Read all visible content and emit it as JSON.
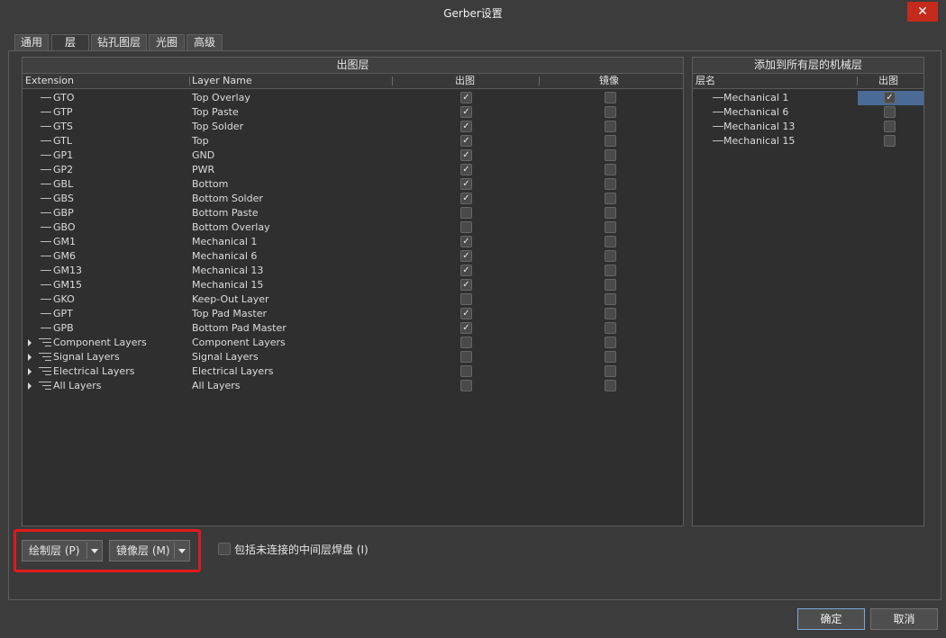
{
  "window": {
    "title": "Gerber设置",
    "close_label": "✕"
  },
  "tabs": [
    "通用",
    "层",
    "钻孔图层",
    "光圈",
    "高级"
  ],
  "left_panel": {
    "title": "出图层",
    "columns": {
      "extension": "Extension",
      "layer_name": "Layer Name",
      "plot": "出图",
      "mirror": "镜像"
    },
    "rows": [
      {
        "ext": "GTO",
        "name": "Top Overlay",
        "plot": true,
        "mirror": false,
        "group": false
      },
      {
        "ext": "GTP",
        "name": "Top Paste",
        "plot": true,
        "mirror": false,
        "group": false
      },
      {
        "ext": "GTS",
        "name": "Top Solder",
        "plot": true,
        "mirror": false,
        "group": false
      },
      {
        "ext": "GTL",
        "name": "Top",
        "plot": true,
        "mirror": false,
        "group": false
      },
      {
        "ext": "GP1",
        "name": "GND",
        "plot": true,
        "mirror": false,
        "group": false
      },
      {
        "ext": "GP2",
        "name": "PWR",
        "plot": true,
        "mirror": false,
        "group": false
      },
      {
        "ext": "GBL",
        "name": "Bottom",
        "plot": true,
        "mirror": false,
        "group": false
      },
      {
        "ext": "GBS",
        "name": "Bottom Solder",
        "plot": true,
        "mirror": false,
        "group": false
      },
      {
        "ext": "GBP",
        "name": "Bottom Paste",
        "plot": false,
        "mirror": false,
        "group": false
      },
      {
        "ext": "GBO",
        "name": "Bottom Overlay",
        "plot": false,
        "mirror": false,
        "group": false
      },
      {
        "ext": "GM1",
        "name": "Mechanical 1",
        "plot": true,
        "mirror": false,
        "group": false
      },
      {
        "ext": "GM6",
        "name": "Mechanical 6",
        "plot": true,
        "mirror": false,
        "group": false
      },
      {
        "ext": "GM13",
        "name": "Mechanical 13",
        "plot": true,
        "mirror": false,
        "group": false
      },
      {
        "ext": "GM15",
        "name": "Mechanical 15",
        "plot": true,
        "mirror": false,
        "group": false
      },
      {
        "ext": "GKO",
        "name": "Keep-Out Layer",
        "plot": false,
        "mirror": false,
        "group": false
      },
      {
        "ext": "GPT",
        "name": "Top Pad Master",
        "plot": true,
        "mirror": false,
        "group": false
      },
      {
        "ext": "GPB",
        "name": "Bottom Pad Master",
        "plot": true,
        "mirror": false,
        "group": false
      },
      {
        "ext": "Component Layers",
        "name": "Component Layers",
        "plot": false,
        "mirror": false,
        "group": true
      },
      {
        "ext": "Signal Layers",
        "name": "Signal Layers",
        "plot": false,
        "mirror": false,
        "group": true
      },
      {
        "ext": "Electrical Layers",
        "name": "Electrical Layers",
        "plot": false,
        "mirror": false,
        "group": true
      },
      {
        "ext": "All Layers",
        "name": "All Layers",
        "plot": false,
        "mirror": false,
        "group": true
      }
    ]
  },
  "right_panel": {
    "title": "添加到所有层的机械层",
    "columns": {
      "layer_name": "层名",
      "plot": "出图"
    },
    "rows": [
      {
        "name": "Mechanical 1",
        "plot": true,
        "selected": true
      },
      {
        "name": "Mechanical 6",
        "plot": false,
        "selected": false
      },
      {
        "name": "Mechanical 13",
        "plot": false,
        "selected": false
      },
      {
        "name": "Mechanical 15",
        "plot": false,
        "selected": false
      }
    ]
  },
  "bottom": {
    "plot_layers_button": "绘制层 (P)",
    "mirror_layers_button": "镜像层 (M)",
    "include_unconnected_label": "包括未连接的中间层焊盘 (I)",
    "include_unconnected_checked": false
  },
  "footer": {
    "ok": "确定",
    "cancel": "取消"
  },
  "colors": {
    "highlight": "#e01a1a",
    "selected_row": "#4a6b95",
    "close": "#c42b1c"
  }
}
